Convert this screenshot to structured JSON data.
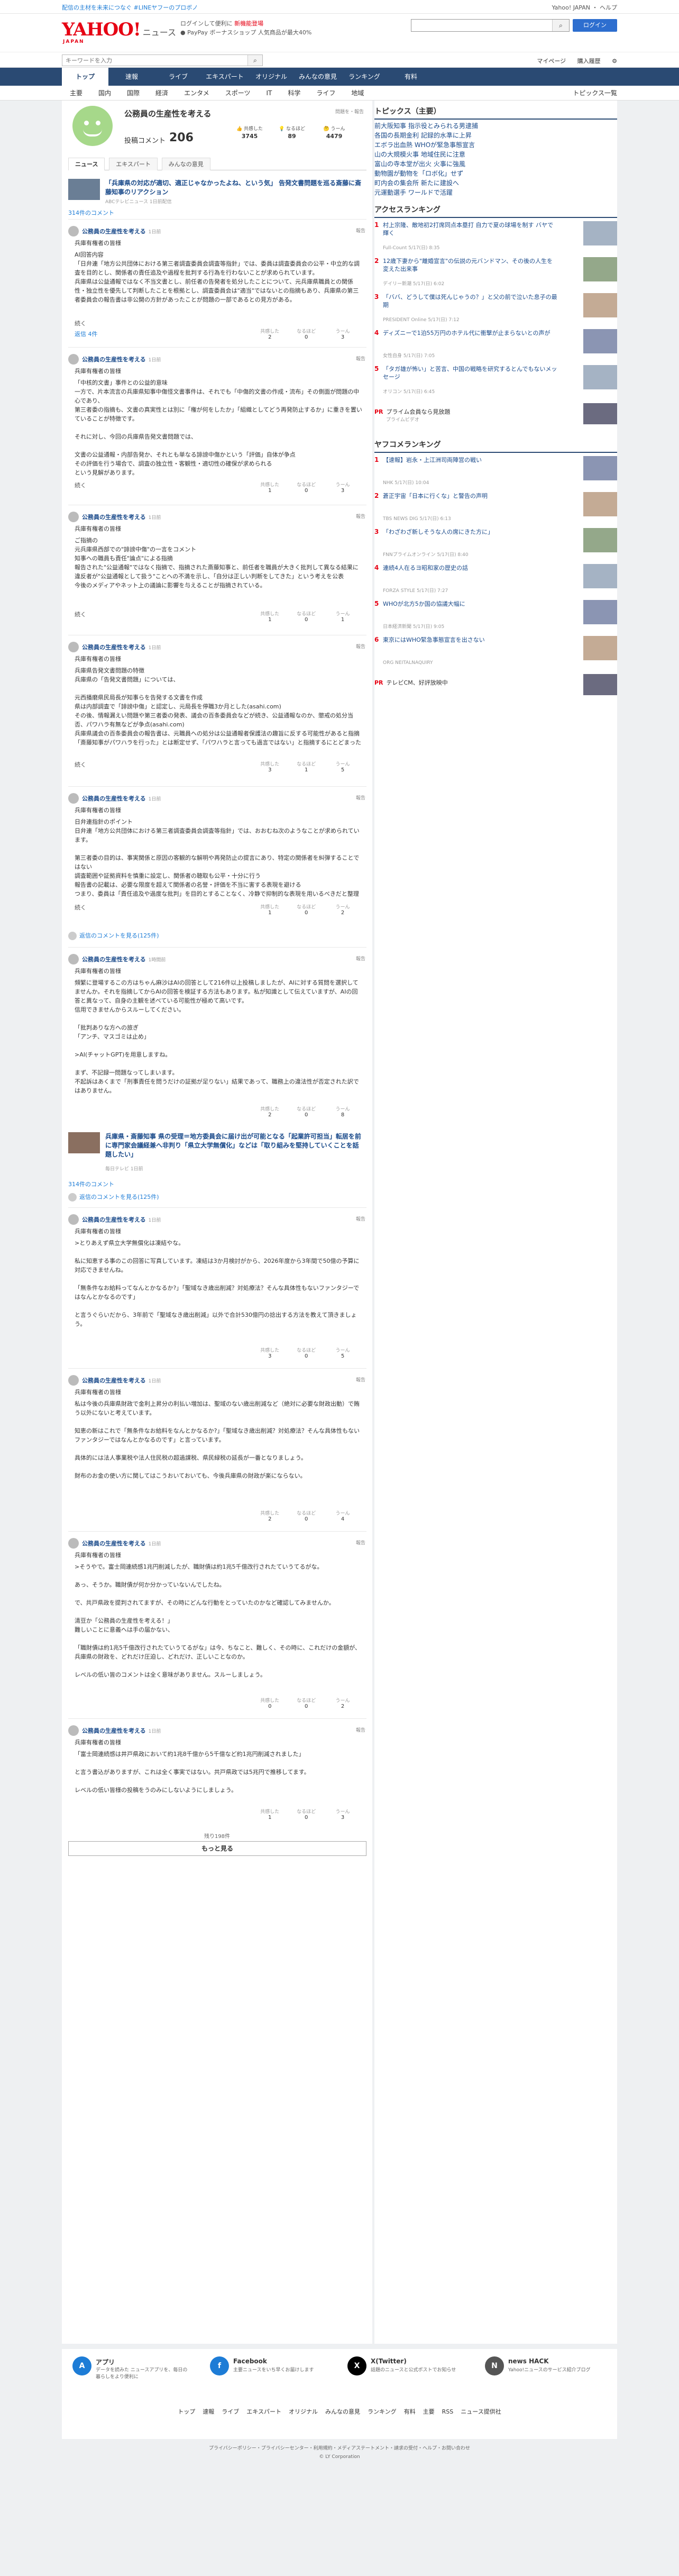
{
  "top": {
    "notice": "配信の主材を未来につなぐ #LINEヤフーのプロボノ",
    "links": [
      "Yahoo! JAPAN",
      "ヘルプ"
    ]
  },
  "header": {
    "logo_main": "YAHOO!",
    "logo_sub": "ニュース",
    "logo_jp": "JAPAN",
    "msg1": "ログインして便利に",
    "msg1_link": "新機能登場",
    "msg2": "PayPay ボーナスショップ",
    "msg3": "人気商品が最大40%",
    "search_placeholder": "",
    "login_label": "ログイン"
  },
  "search_row": {
    "placeholder": "キーワードを入力",
    "mypage": "マイページ",
    "purchase": "購入履歴"
  },
  "nav": {
    "items": [
      "トップ",
      "速報",
      "ライブ",
      "エキスパート",
      "オリジナル",
      "みんなの意見",
      "ランキング",
      "有料"
    ]
  },
  "subnav": {
    "items": [
      "主要",
      "国内",
      "国際",
      "経済",
      "エンタメ",
      "スポーツ",
      "IT",
      "科学",
      "ライフ",
      "地域"
    ],
    "more": "トピックス一覧"
  },
  "topic": {
    "title": "公務員の生産性を考える",
    "report": "問題を・報告",
    "post_label": "投稿コメント",
    "post_count": "206",
    "reactions": [
      {
        "label": "共感した",
        "value": "3745"
      },
      {
        "label": "なるほど",
        "value": "89"
      },
      {
        "label": "うーん",
        "value": "4479"
      }
    ],
    "tabs": [
      "ニュース",
      "エキスパート",
      "みんなの意見"
    ]
  },
  "articles": [
    {
      "title": "「兵庫県の対応が適切、適正じゃなかったよね、という気」 告発文書問題を巡る斎藤に斎藤知事のリアクション",
      "source": "ABCテレビニュース 1日前配信"
    },
    {
      "title": "兵庫県・斎藤知事 県の受理＝地方委員会に届け出が可能となる「起業許可担当」転居を前に専門家会議経兼へ非判り「県立大学無償化」などは「取り組みを堅持していくことを話題したい」",
      "source": "毎日テレビ 1日前"
    }
  ],
  "comment_counts": [
    "314件のコメント",
    "314件のコメント"
  ],
  "comments": [
    {
      "name": "公務員の生産性を考える",
      "time": "1日前",
      "expert": "兵庫有権者の皆様",
      "body": "AI回答内容\n「日弁連「地方公共団体における第三者調査委員会調査等指針」では、委員は調査委員会の公平・中立的な調査を目的とし、関係者の責任追及や過程を批判する行為を行わないことが求められています。\n兵庫県は公益通報ではなく不当文書とし、前任者の告発者を処分したことについて、元兵庫県職員との関係性・独立性を優先して判断したことを根拠とし、調査委員会は\"適当\"ではないとの指摘もあり、兵庫県の第三者委員会の報告書は非公開の方針があったことが問題の一部であるとの見方がある。",
      "more": "続く",
      "replies_label": "返信 4件",
      "r1": "2",
      "r2": "0",
      "r3": "3"
    },
    {
      "name": "公務員の生産性を考える",
      "time": "1日前",
      "expert": "兵庫有権者の皆様",
      "body": "「中核的文書」事件との公益的意味\n一方で、片本流言の兵庫県知事中傷怪文書事件は、それでも「中傷的文書の作成・流布」その側面が問題の中心であり、\n第三者委の指摘も、文書の真実性とは別に「権が何をしたか」「組織としてどう再発防止するか」に重きを置いていることが特徴です。\n\nそれに対し、今回の兵庫県告発文書問題では、\n\n文書の公益通報・内部告発か、それとも単なる誹謗中傷かという「評価」自体が争点\nその評価を行う場合で、調査の独立性・客観性・適切性の確保が求められる\nという見解があります。\n\n今後の論点は「第三者委員会の報告」を受けて県がどのように対応するかであり、「公益通報」が認められた場合は、通報者保護の観点からも再検討が求められると考えます。",
      "more": "続く",
      "r1": "1",
      "r2": "0",
      "r3": "3"
    },
    {
      "name": "公務員の生産性を考える",
      "time": "1日前",
      "expert": "兵庫有権者の皆様",
      "body": "ご指摘の\n元兵庫県西部での\"誹謗中傷\"の一言をコメント\n知事への職員も責任\"論点\"による指摘\n報告された\"公益通報\"ではなく指摘で、指摘された斎藤知事と、前任者を職員が大きく批判して異なる結果に\n違反者が\"公益通報として扱う\"ことへの不満を示し、「自分は正しい判断をしてきた」という考えを公表\n今後のメディアやネット上の議論に影響を与えることが指摘されている。",
      "more": "続く",
      "r1": "1",
      "r2": "0",
      "r3": "1"
    },
    {
      "name": "公務員の生産性を考える",
      "time": "1日前",
      "expert": "兵庫有権者の皆様",
      "body": "兵庫県告発文書問題の特徴\n兵庫県の「告発文書問題」については、\n\n元西播磨県民局長が知事らを告発する文書を作成\n県は内部調査で「誹謗中傷」と認定し、元局長を停職3か月とした(asahi.com)\nその後、情報漏えい問題や第三者委の発表、議会の百条委員会などが続き、公益通報なのか、懲戒の処分当否、パワハラ有無などが争点(asahi.com)\n兵庫県議会の百条委員会の報告書は、元職員への処分は公益通報者保護法の趣旨に反する可能性があると指摘\n「斎藤知事がパワハラを行った」とは断定せず、「パワハラと言っても過言ではない」と指摘するにとどまった",
      "more": "続く",
      "r1": "3",
      "r2": "1",
      "r3": "5"
    },
    {
      "name": "公務員の生産性を考える",
      "time": "1日前",
      "expert": "兵庫有権者の皆様",
      "body": "日弁連指針のポイント\n日弁連「地方公共団体における第三者調査委員会調査等指針」では、おおむね次のようなことが求められています。\n\n第三者委の目的は、事実関係と原因の客観的な解明や再発防止の提言にあり、特定の関係者を糾弾することではない\n調査範囲や証拠資料を慎重に設定し、関係者の聴取も公平・十分に行う\n報告書の記載は、必要な限度を超えて関係者の名誉・評価を不当に害する表現を避ける\nつまり、委員は「責任追及や過度な批判」を目的とすることなく、冷静で抑制的な表現を用いるべきだと整理できます。(partsa.nikkei.com)",
      "more": "続く",
      "r1": "1",
      "r2": "0",
      "r3": "2"
    },
    {
      "name": "公務員の生産性を考える",
      "time": "1時間前",
      "expert": "兵庫有権者の皆様",
      "body": "頻繁に登場するこの方はちゃん麻沙はAIの回答として216件以上投稿しましたが、AIに対する質問を選択してませんか。それを指摘してからAIの回答を検証する方法もあります。私が知識として伝えていますが、AIの回答と異なって、自身の主観を述べている可能性が極めて高いです。\n信用できませんからスルーしてください。\n\n「批判ありな方への旅ぎ\n「アンチ、マスゴミは止め」\n\n>AI(チャットGPT)を用意しますね。\n\nまず、不記録一問題なってしまいます。\n不起訴はあくまで「刑事責任を問うだけの証拠が足りない」結果であって、職務上の違法性が否定された訳ではありません。",
      "more": "",
      "r1": "2",
      "r2": "0",
      "r3": "8"
    },
    {
      "name": "公務員の生産性を考える",
      "time": "1日前",
      "expert": "兵庫有権者の皆様",
      "body": ">とりあえず県立大学無償化は凍結やな。\n\n私に知恵する事のこの回答に写真しています。凍結は3か月検討がから、2026年度から3年間で50億の予算に対応できませんね。\n\n「無条件なお給料ってなんとかなるか?」「聖域なき歳出削減？対処療法？そんな具体性もないファンタジーではなんとかなるのです」\n\nと言うぐらいだから、3年前で「聖域なき歳出削減」以外で合計530億円の捻出する方法を教えて頂きましょう。",
      "more": "",
      "r1": "3",
      "r2": "0",
      "r3": "5"
    },
    {
      "name": "公務員の生産性を考える",
      "time": "1日前",
      "expert": "兵庫有権者の皆様",
      "body": "私は今後の兵庫県財政で金利上昇分の利払い増加は、聖域のない歳出削減など（絶対に必要な財政出動）で賄う以外にないと考えています。\n\n知恵の新はこれで「無条件なお給料をなんとかなるか?」「聖域なき歳出削減？対処療法？そんな具体性もないファンタジーではなんとかなるのです」と言っています。\n\n具体的には法人事業税や法人住民税の超過課税、県民緑税の延長が一番となりましょう。\n\n財布のお金の使い方に関してはこうおいておいても、今後兵庫県の財政が楽にならない。",
      "more": "",
      "r1": "2",
      "r2": "0",
      "r3": "4"
    },
    {
      "name": "公務員の生産性を考える",
      "time": "1日前",
      "expert": "兵庫有権者の皆様",
      "body": ">そうやで。富士岡連続感1兆円削減したが、職財債は約1兆5千億改行されたていうてるがな。\n\nあっ、そうか。職財債が何か分かっていないんでしたね。\n\nで、共戸県政を提判されてますが、その時にどんな行動をとっていたのかなど確認してみませんか。\n\n清豆か「公務員の生産性を考える！」\n難しいことに意義へは手の届かない、\n\n「職財債は約1兆5千億改行されたていうてるがな」は今、ちなこと、難しく、その時に、これだけの金額が、兵庫県の財政を、どれだけ圧迫し、どれだけ、正しいことなのか。\n\nレベルの低い皆のコメントは全く意味がありません。スルーしましょう。",
      "more": "",
      "r1": "0",
      "r2": "0",
      "r3": "2"
    },
    {
      "name": "公務員の生産性を考える",
      "time": "1日前",
      "expert": "兵庫有権者の皆様",
      "body": "「富士岡連続感は井戸県政において約1兆8千億から5千億など約1兆円削減されました」\n\nと言う書込がありますが、これは全く事実ではない。共戸県政では5兆円で推移してます。\n\nレベルの低い皆様の投稿をうのみにしないようにしましょう。",
      "more": "",
      "r1": "1",
      "r2": "0",
      "r3": "3"
    }
  ],
  "reply_link": "返信のコメントを見る(125件)",
  "more_count": "残り198件",
  "more_button": "もっと見る",
  "reaction_labels": [
    "共感した",
    "なるほど",
    "うーん"
  ],
  "report_label": "報告",
  "sidebar": {
    "topics_title": "トピックス（主要）",
    "topics": [
      "前大阪知事 指示役とみられる男逮捕",
      "各国の長期金利 記録的水準に上昇",
      "エボラ出血熱 WHOが緊急事態宣言",
      "山の大規模火事 地域住民に注意",
      "富山の寺本堂が出火 火事に強風",
      "動物園が動物を「ロボ化」せず",
      "町内会の集会所 新たに建設へ",
      "元運動選手 ワールドで活躍"
    ],
    "access_title": "アクセスランキング",
    "access": [
      {
        "text": "村上宗隆、敵地初2打席同点本塁打 自力で夏の球場を制す バヤで輝く",
        "src": "Full-Count 5/17(日) 8:35"
      },
      {
        "text": "12歳下妻から\"離婚宣言\"の伝説の元バンドマン、その後の人生を変えた出来事",
        "src": "デイリー新潮 5/17(日) 6:02"
      },
      {
        "text": "「ババ、どうして僕は死んじゃうの？」と父の前で泣いた息子の最期",
        "src": "PRESIDENT Online 5/17(日) 7:12"
      },
      {
        "text": "ディズニーで1泊55万円のホテル代に衝撃が止まらないとの声が",
        "src": "女性自身 5/17(日) 7:05"
      },
      {
        "text": "「タガ雄が怖い」と苦言、中国の戦略を研究するとんでもないメッセージ",
        "src": "オリコン 5/17(日) 6:45"
      }
    ],
    "pr1": "プライム会員なら見放題",
    "pr1_sub": "プライムビデオ",
    "yahoo_title": "ヤフコメランキング",
    "yahoo": [
      {
        "text": "【速報】岩永・上江洲司両陣営の戦い",
        "src": "NHK 5/17(日) 10:04"
      },
      {
        "text": "蒼正宇宙「日本に行くな」と警告の声明",
        "src": "TBS NEWS DIG 5/17(日) 6:13"
      },
      {
        "text": "「わざわざ新しそうな人の席にきた方に」",
        "src": "FNNプライムオンライン 5/17(日) 8:40"
      },
      {
        "text": "連続4人在るヨ昭和家の歴史の話",
        "src": "FORZA STYLE 5/17(日) 7:27"
      },
      {
        "text": "WHOが北方5か国の協議大幅に",
        "src": "日本経済新聞 5/17(日) 9:05"
      },
      {
        "text": "東京にはWHO緊急事態宣言を出さない",
        "src": "ORG NEITALNAQUIRY"
      }
    ],
    "pr2": "テレビCM、好評放映中"
  },
  "footer": {
    "blocks": [
      {
        "icon": "A",
        "name": "アプリ",
        "desc": "データを読みた ニュースアプリを、毎日の暮らしをより便利に"
      },
      {
        "icon": "f",
        "name": "Facebook",
        "desc": "主要ニュースをいち早くお届けします"
      },
      {
        "icon": "X",
        "name": "X(Twitter)",
        "desc": "話題のニュースと公式ポストでお知らせ"
      },
      {
        "icon": "N",
        "name": "news HACK",
        "desc": "Yahoo!ニュースのサービス紹介ブログ"
      }
    ],
    "links": [
      "トップ",
      "速報",
      "ライブ",
      "エキスパート",
      "オリジナル",
      "みんなの意見",
      "ランキング",
      "有料",
      "主要",
      "RSS",
      "ニュース提供社"
    ],
    "legal": "プライバシーポリシー・プライバシーセンター・利用規約・メディアステートメント・請求の受付・ヘルプ・お問い合わせ",
    "copyright": "© LY Corporation"
  }
}
